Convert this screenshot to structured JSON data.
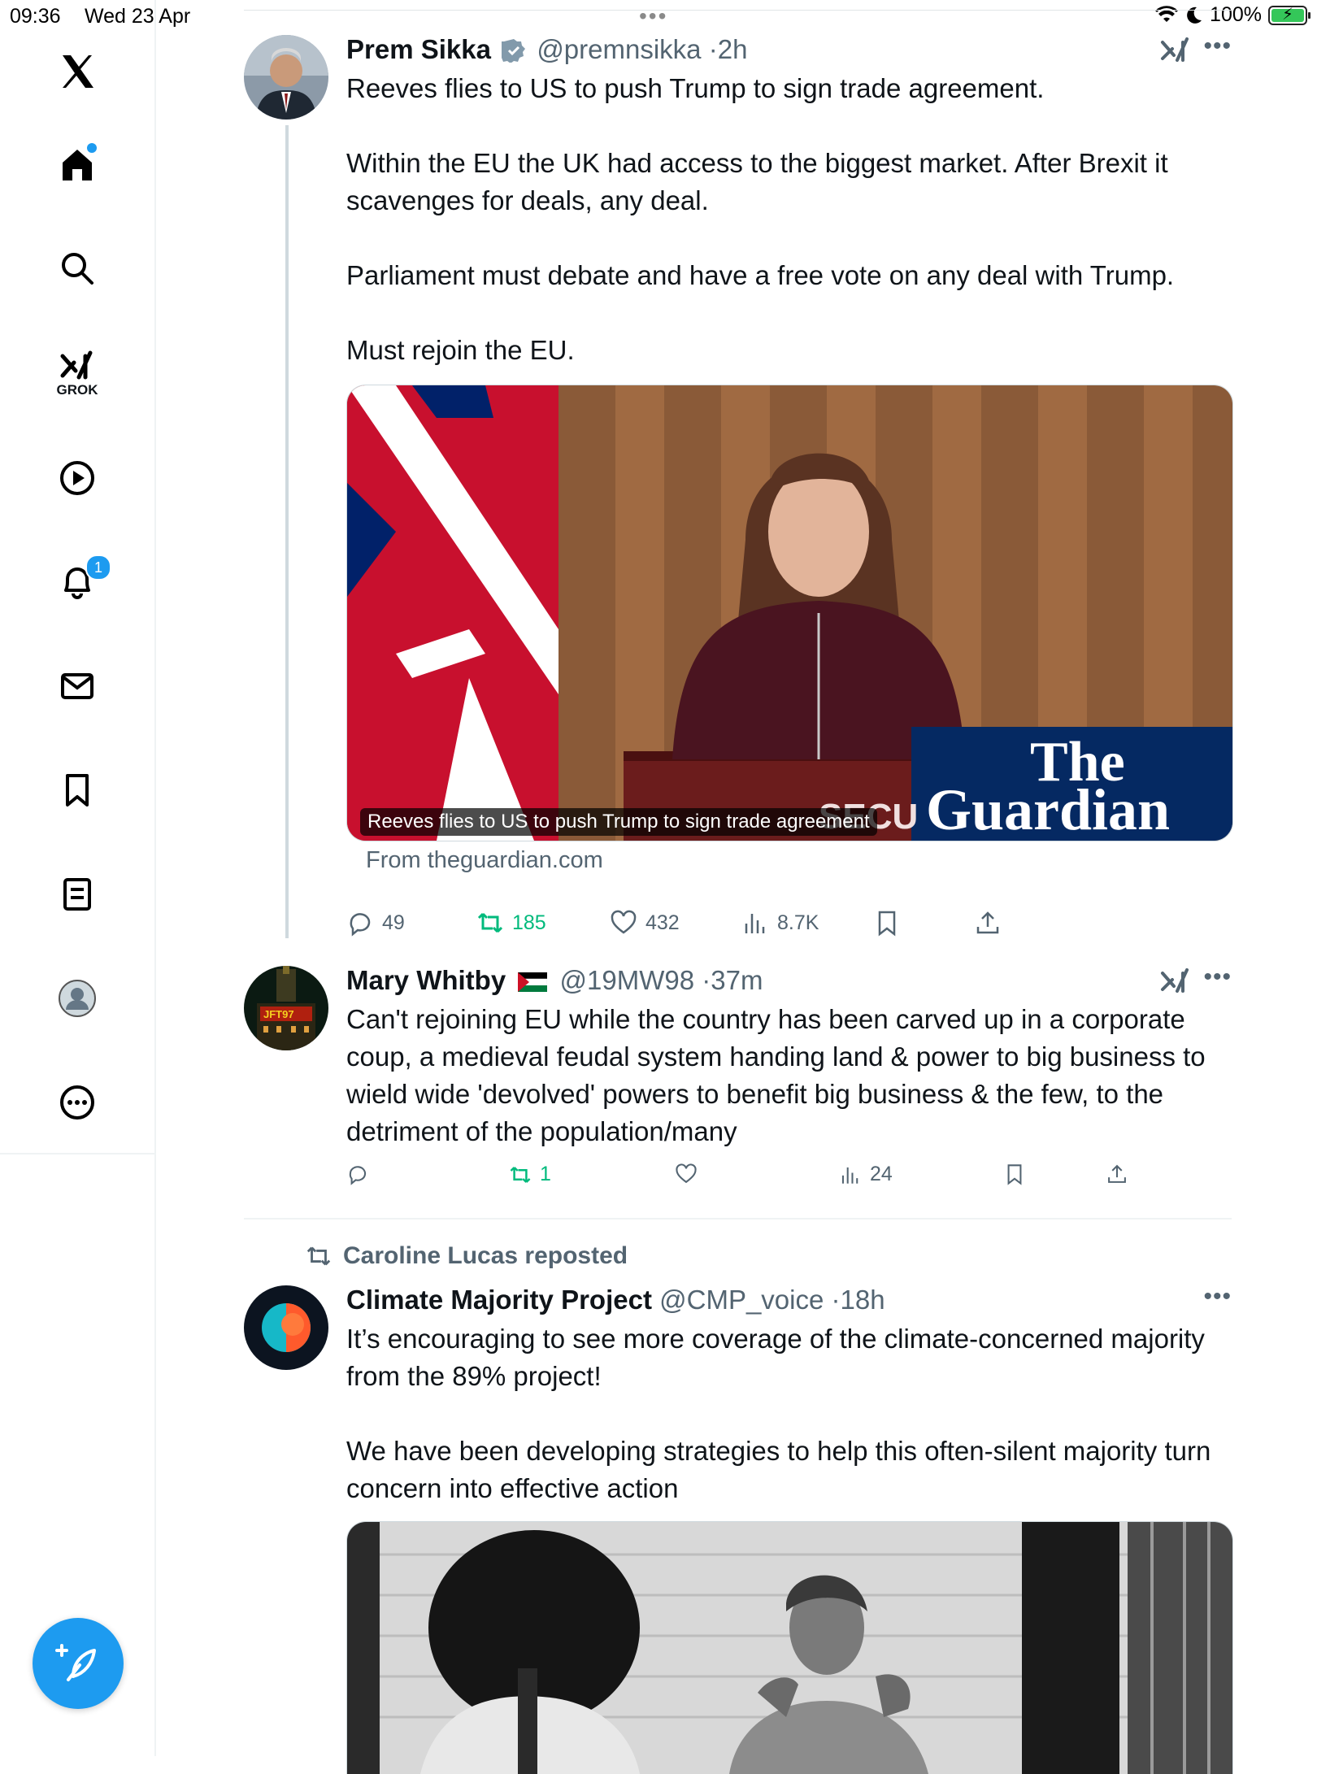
{
  "status_bar": {
    "time": "09:36",
    "date": "Wed 23 Apr",
    "battery": "100%",
    "battery_level": 1.0
  },
  "sidebar": {
    "items": [
      "home",
      "search",
      "grok",
      "videos",
      "notifications",
      "messages",
      "bookmarks",
      "lists",
      "profile",
      "more"
    ],
    "grok_label": "GROK",
    "notifications_badge": "1"
  },
  "tweets": [
    {
      "name": "Prem Sikka",
      "handle": "@premnsikka",
      "time": "2h",
      "paragraphs": [
        "Reeves flies to US to push Trump to sign trade agreement.",
        "Within the EU the UK had access to the biggest market. After Brexit it scavenges for deals, any deal.",
        "Parliament must debate and have a free vote on any deal with Trump.",
        "Must rejoin the EU."
      ],
      "card_caption": "Reeves flies to US to push Trump to sign trade agreement",
      "card_logo_line1": "The",
      "card_logo_line2": "Guardian",
      "card_podium_text": "SECU",
      "card_source": "From theguardian.com",
      "replies": "49",
      "reposts": "185",
      "likes": "432",
      "views": "8.7K"
    },
    {
      "name": "Mary Whitby",
      "handle": "@19MW98",
      "time": "37m",
      "avatar_text": "JFT97",
      "paragraphs": [
        "Can't rejoining EU while the country has been carved up in a corporate coup, a medieval feudal system handing land & power to big business to wield wide 'devolved' powers to benefit big business & the few, to the detriment of the population/many"
      ],
      "reposts": "1",
      "views": "24"
    },
    {
      "reposted_by": "Caroline Lucas reposted",
      "name": "Climate Majority Project",
      "handle": "@CMP_voice",
      "time": "18h",
      "paragraphs": [
        "It’s encouraging to see more coverage of the climate-concerned majority from the 89% project!",
        "We have been developing strategies to help this often-silent majority turn concern into effective action"
      ]
    }
  ],
  "colors": {
    "accent": "#1d9bf0",
    "repost_green": "#00ba7c",
    "guardian_blue": "#052962"
  }
}
